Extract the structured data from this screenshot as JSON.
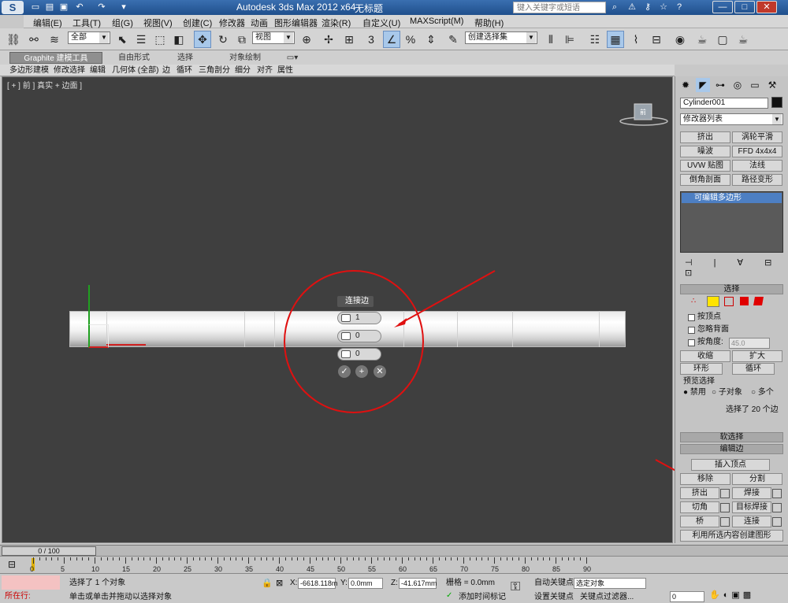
{
  "titlebar": {
    "app_logo": "S",
    "title": "Autodesk 3ds Max  2012 x64",
    "file": "无标题",
    "search_placeholder": "键入关键字或短语",
    "icons": [
      "binoculars-icon",
      "comm-icon",
      "star-icon",
      "help-icon"
    ]
  },
  "menu": [
    "编辑(E)",
    "工具(T)",
    "组(G)",
    "视图(V)",
    "创建(C)",
    "修改器",
    "动画",
    "图形编辑器",
    "渲染(R)",
    "自定义(U)",
    "MAXScript(M)",
    "帮助(H)"
  ],
  "toolbar": {
    "selection_filter": "全部",
    "ref_coord": "视图",
    "named_selection": "创建选择集"
  },
  "ribbon": {
    "tabs": [
      "Graphite 建模工具",
      "自由形式",
      "选择",
      "对象绘制"
    ],
    "sub_items": [
      "多边形建模",
      "修改选择",
      "编辑",
      "几何体 (全部)",
      "边",
      "循环",
      "三角剖分",
      "细分",
      "对齐",
      "属性"
    ]
  },
  "viewport": {
    "label": "[ + ] 前 ] 真实 + 边面 ]",
    "viewcube_label": "前"
  },
  "caddy": {
    "title": "连接边",
    "segments": "1",
    "pinch": "0",
    "slide": "0",
    "ok": "✓",
    "apply": "+",
    "cancel": "✕"
  },
  "cmdpanel": {
    "object_name": "Cylinder001",
    "modifier_list": "修改器列表",
    "mod_buttons": [
      "挤出",
      "涡轮平滑",
      "噪波",
      "FFD 4x4x4",
      "UVW 贴图",
      "法线",
      "倒角剖面",
      "路径变形"
    ],
    "stack_item": "可编辑多边形",
    "rollouts": {
      "selection": "选择",
      "by_vertex": "按顶点",
      "ignore_backfacing": "忽略背面",
      "by_angle": "按角度:",
      "by_angle_value": "45.0",
      "shrink": "收缩",
      "grow": "扩大",
      "ring": "环形",
      "loop": "循环",
      "preview_selection": "预览选择",
      "disabled": "禁用",
      "subobject": "子对象",
      "multi": "多个",
      "selected_count": "选择了 20 个边",
      "soft_selection": "软选择",
      "edit_edges": "编辑边",
      "insert_vertex": "插入顶点",
      "remove": "移除",
      "split": "分割",
      "extrude": "挤出",
      "weld": "焊接",
      "chamfer": "切角",
      "target_weld": "目标焊接",
      "bridge": "桥",
      "connect": "连接",
      "create_shape": "利用所选内容创建图形"
    }
  },
  "timeline": {
    "slider": "0 / 100",
    "ticks": [
      "0",
      "5",
      "10",
      "15",
      "20",
      "25",
      "30",
      "35",
      "40",
      "45",
      "50",
      "55",
      "60",
      "65",
      "70",
      "75",
      "80",
      "85",
      "90"
    ]
  },
  "status": {
    "in_progress": "所在行:",
    "selected": "选择了 1 个对象",
    "prompt": "单击或单击并拖动以选择对象",
    "x_label": "X:",
    "x_value": "-6618.118m",
    "y_label": "Y:",
    "y_value": "0.0mm",
    "z_label": "Z:",
    "z_value": "-41.617mm",
    "grid": "栅格 = 0.0mm",
    "auto_key": "自动关键点",
    "selected_object": "选定对象",
    "set_key": "设置关键点",
    "key_filters": "关键点过滤器...",
    "add_time_tag": "添加时间标记",
    "frame": "0"
  }
}
